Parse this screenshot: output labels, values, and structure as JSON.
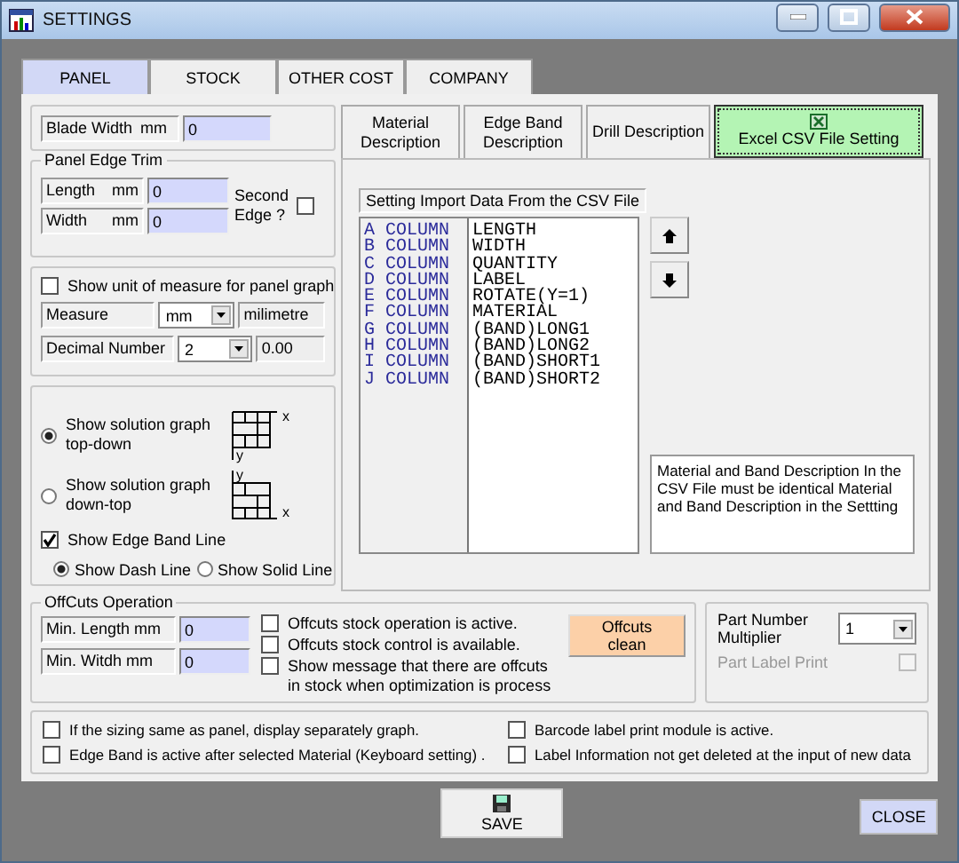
{
  "window": {
    "title": "SETTINGS"
  },
  "tabs": [
    {
      "label": "PANEL",
      "selected": true
    },
    {
      "label": "STOCK",
      "selected": false
    },
    {
      "label": "OTHER COST",
      "selected": false
    },
    {
      "label": "COMPANY",
      "selected": false
    }
  ],
  "blade_width": {
    "label": "Blade Width",
    "unit": "mm",
    "value": "0"
  },
  "panel_edge_trim": {
    "title": "Panel Edge Trim",
    "fields": [
      {
        "label": "Length",
        "unit": "mm",
        "value": "0"
      },
      {
        "label": "Width",
        "unit": "mm",
        "value": "0"
      }
    ],
    "second_edge": {
      "label": "Second Edge ?",
      "checked": false
    }
  },
  "unit_graph": {
    "checkbox": {
      "label": "Show unit of measure for panel graph",
      "checked": false
    },
    "measure": {
      "label": "Measure",
      "value": "mm",
      "name": "milimetre"
    },
    "decimal": {
      "label": "Decimal Number",
      "value": "2",
      "preview": "0.00"
    }
  },
  "graph_direction": [
    {
      "label": "Show solution graph top-down",
      "kind": "top-down",
      "selected": true,
      "x_label": "x",
      "y_label": "y"
    },
    {
      "label": "Show solution graph down-top",
      "kind": "down-top",
      "selected": false,
      "x_label": "x",
      "y_label": "y"
    }
  ],
  "edge_band": {
    "label": "Show Edge Band Line",
    "checked": true,
    "styles": [
      {
        "label": "Show Dash Line",
        "selected": true
      },
      {
        "label": "Show Solid Line",
        "selected": false
      }
    ]
  },
  "sub_tabs": [
    {
      "label": "Material Description",
      "selected": false,
      "icon": false
    },
    {
      "label": "Edge Band Description",
      "selected": false,
      "icon": false
    },
    {
      "label": "Drill Description",
      "selected": false,
      "icon": false
    },
    {
      "label": "Excel CSV File Setting",
      "selected": true,
      "icon": true
    }
  ],
  "csv": {
    "title": "Setting Import Data From the CSV File",
    "rows": [
      {
        "column": "A COLUMN",
        "field": "LENGTH"
      },
      {
        "column": "B COLUMN",
        "field": "WIDTH"
      },
      {
        "column": "C COLUMN",
        "field": "QUANTITY"
      },
      {
        "column": "D COLUMN",
        "field": "LABEL"
      },
      {
        "column": "E COLUMN",
        "field": "ROTATE(Y=1)"
      },
      {
        "column": "F COLUMN",
        "field": "MATERIAL"
      },
      {
        "column": "G COLUMN",
        "field": "(BAND)LONG1"
      },
      {
        "column": "H COLUMN",
        "field": "(BAND)LONG2"
      },
      {
        "column": "I COLUMN",
        "field": "(BAND)SHORT1"
      },
      {
        "column": "J COLUMN",
        "field": "(BAND)SHORT2"
      }
    ],
    "note": "Material and Band Description In the CSV File must be identical Material and Band Description in the Settting"
  },
  "offcuts": {
    "title": "OffCuts Operation",
    "fields": [
      {
        "label": "Min. Length",
        "unit": "mm",
        "value": "0"
      },
      {
        "label": "Min. Witdh",
        "unit": "mm",
        "value": "0"
      }
    ],
    "options": [
      {
        "label": "Offcuts stock operation is active.",
        "checked": false
      },
      {
        "label": "Offcuts stock control is available.",
        "checked": false
      },
      {
        "label": "Show message that there are offcuts in stock when optimization is process",
        "checked": false
      }
    ],
    "clean_button": "Offcuts clean"
  },
  "part_number": {
    "label": "Part Number Multiplier",
    "value": "1",
    "label_print": {
      "label": "Part Label Print",
      "checked": false,
      "disabled": true
    }
  },
  "general_options": [
    {
      "label": "If the sizing same as panel, display separately graph.",
      "checked": false
    },
    {
      "label": "Barcode label print module is active.",
      "checked": false
    },
    {
      "label": "Edge Band is active after selected Material (Keyboard setting) .",
      "checked": false
    },
    {
      "label": "Label Information not get deleted at the input of new data",
      "checked": false
    }
  ],
  "buttons": {
    "save": "SAVE",
    "close": "CLOSE"
  }
}
